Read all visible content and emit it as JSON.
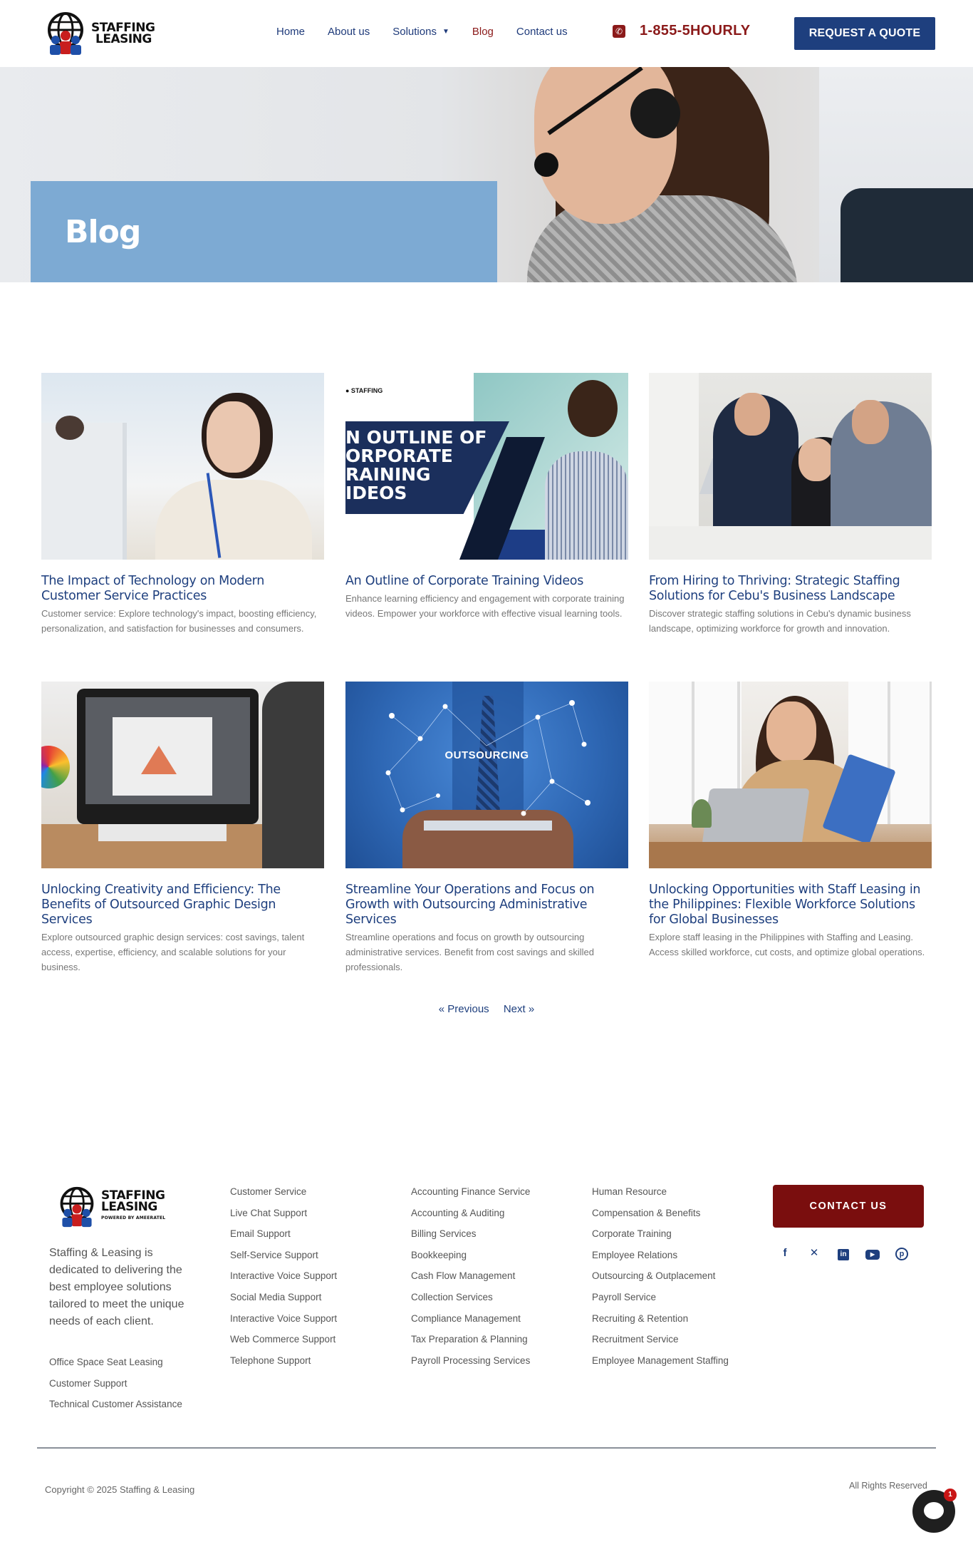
{
  "brand": {
    "logo_line1": "STAFFING",
    "logo_line2": "LEASING",
    "footer_tagline": "POWERED BY AMEERATEL"
  },
  "nav": {
    "items": [
      {
        "label": "Home"
      },
      {
        "label": "About us"
      },
      {
        "label": "Solutions"
      },
      {
        "label": "Blog"
      },
      {
        "label": "Contact us"
      }
    ],
    "active": "Blog",
    "phone": "1-855-5HOURLY",
    "quote_button": "REQUEST A QUOTE"
  },
  "hero": {
    "title": "Blog"
  },
  "posts": [
    {
      "title": "The Impact of Technology on Modern Customer Service Practices",
      "excerpt": "Customer service: Explore technology's impact, boosting efficiency, personalization, and satisfaction for businesses and consumers."
    },
    {
      "title": "An Outline of Corporate Training Videos",
      "excerpt": "Enhance learning efficiency and engagement with corporate training videos. Empower your workforce with effective visual learning tools.",
      "image_text": [
        "N OUTLINE OF",
        "ORPORATE",
        "RAINING",
        "IDEOS"
      ]
    },
    {
      "title": "From Hiring to Thriving: Strategic Staffing Solutions for Cebu's Business Landscape",
      "excerpt": "Discover strategic staffing solutions in Cebu's dynamic business landscape, optimizing workforce for growth and innovation."
    },
    {
      "title": "Unlocking Creativity and Efficiency: The Benefits of Outsourced Graphic Design Services",
      "excerpt": "Explore outsourced graphic design services: cost savings, talent access, expertise, efficiency, and scalable solutions for your business."
    },
    {
      "title": "Streamline Your Operations and Focus on Growth with Outsourcing Administrative Services",
      "excerpt": "Streamline operations and focus on growth by outsourcing administrative services. Benefit from cost savings and skilled professionals.",
      "image_text": "OUTSOURCING"
    },
    {
      "title": "Unlocking Opportunities with Staff Leasing in the Philippines: Flexible Workforce Solutions for Global Businesses",
      "excerpt": "Explore staff leasing in the Philippines with Staffing and Leasing. Access skilled workforce, cut costs, and optimize global operations."
    }
  ],
  "pagination": {
    "previous": "« Previous",
    "next": "Next »"
  },
  "footer": {
    "about": "Staffing & Leasing is dedicated to delivering the best employee solutions tailored to meet the unique needs of each client.",
    "extra_links": [
      "Office Space Seat Leasing",
      "Customer Support",
      "Technical Customer Assistance"
    ],
    "col1": [
      "Customer Service",
      "Live Chat Support",
      "Email Support",
      "Self-Service Support",
      "Interactive Voice Support",
      "Social Media Support",
      "Interactive Voice Support",
      "Web Commerce Support",
      "Telephone Support"
    ],
    "col2": [
      "Accounting Finance Service",
      "Accounting & Auditing",
      "Billing Services",
      "Bookkeeping",
      "Cash Flow Management",
      "Collection Services",
      "Compliance Management",
      "Tax Preparation & Planning",
      "Payroll Processing Services"
    ],
    "col3": [
      "Human Resource",
      "Compensation & Benefits",
      "Corporate Training",
      "Employee Relations",
      "Outsourcing & Outplacement",
      "Payroll Service",
      "Recruiting & Retention",
      "Recruitment Service",
      "Employee Management Staffing"
    ],
    "contact_button": "CONTACT US",
    "social_icons": [
      "facebook-icon",
      "x-icon",
      "linkedin-icon",
      "youtube-icon",
      "pinterest-icon"
    ],
    "copyright": "Copyright © 2025 Staffing & Leasing",
    "rights": "All Rights Reserved"
  },
  "chat": {
    "badge": "1"
  },
  "colors": {
    "navy": "#1e3f7e",
    "maroon": "#7a0e0e",
    "hero_box": "#7daad3"
  }
}
